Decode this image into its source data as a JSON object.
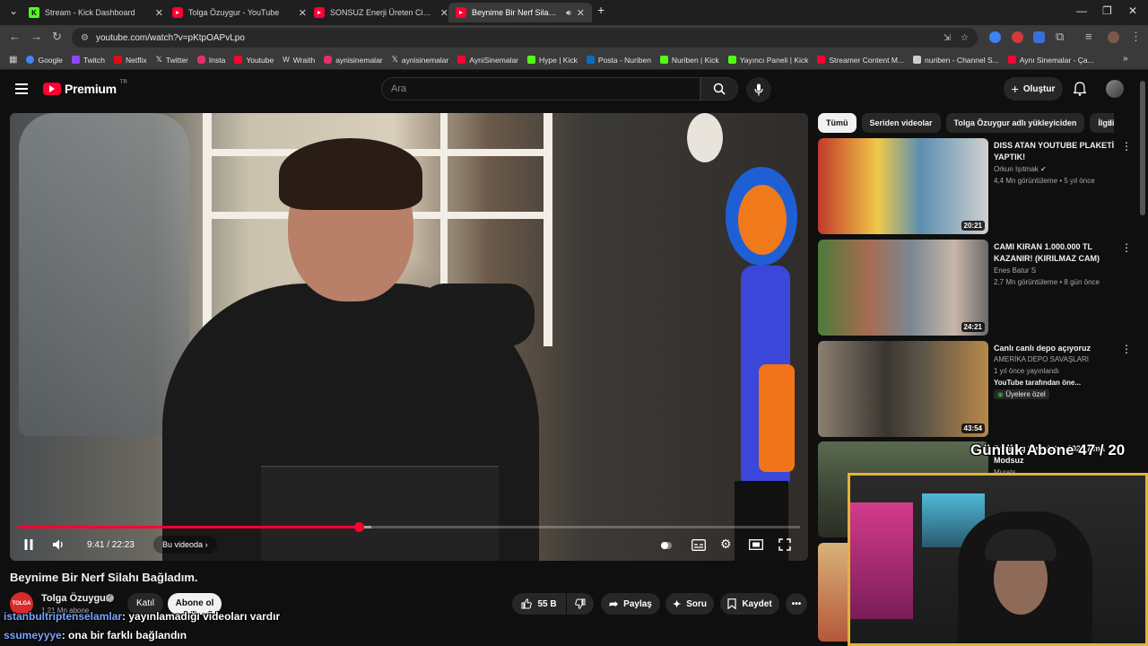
{
  "browser": {
    "tabs": [
      {
        "label": "Stream - Kick Dashboard",
        "icon": "kick-icon"
      },
      {
        "label": "Tolga Özuygur - YouTube",
        "icon": "youtube-icon"
      },
      {
        "label": "SONSUZ Enerji Üreten Cihaz Ya",
        "icon": "youtube-icon"
      },
      {
        "label": "Beynime Bir Nerf Silahı Bağ",
        "icon": "youtube-icon"
      }
    ],
    "url": "youtube.com/watch?v=pKtpOAPvLpo",
    "bookmarks": [
      {
        "label": "Google",
        "color": "#4285f4"
      },
      {
        "label": "Twitch",
        "color": "#9146ff"
      },
      {
        "label": "Netflix",
        "color": "#e50914"
      },
      {
        "label": "Twitter",
        "color": "#e8e8e8"
      },
      {
        "label": "Insta",
        "color": "#e1306c"
      },
      {
        "label": "Youtube",
        "color": "#ff0033"
      },
      {
        "label": "Wraith",
        "color": "#cccccc"
      },
      {
        "label": "aynisinemalar",
        "color": "#e1306c"
      },
      {
        "label": "aynisinemalar",
        "color": "#e8e8e8"
      },
      {
        "label": "AyniSinemalar",
        "color": "#ff0033"
      },
      {
        "label": "Hype | Kick",
        "color": "#53fc18"
      },
      {
        "label": "Posta - Nuriben",
        "color": "#0f6cbd"
      },
      {
        "label": "Nuriben | Kick",
        "color": "#53fc18"
      },
      {
        "label": "Yayıncı Paneli | Kick",
        "color": "#53fc18"
      },
      {
        "label": "Streamer Content M...",
        "color": "#ff0033"
      },
      {
        "label": "nuriben - Channel S...",
        "color": "#cccccc"
      },
      {
        "label": "Aynı Sinemalar - Ça...",
        "color": "#ff0033"
      }
    ]
  },
  "youtube": {
    "logo_word": "Premium",
    "logo_region": "TR",
    "search_placeholder": "Ara",
    "create_label": "Oluştur"
  },
  "video": {
    "title": "Beynime Bir Nerf Silahı Bağladım.",
    "time": "9:41 / 22:23",
    "chapter": "Bu videoda",
    "progress": 0.436,
    "buffered": 0.452,
    "channel": {
      "name": "Tolga Özuygur",
      "avatar_text": "TOLGA",
      "subscribers": "1,21 Mn abone",
      "join_label": "Katıl",
      "subscribe_label": "Abone ol"
    },
    "actions": {
      "likes": "55 B",
      "share": "Paylaş",
      "ask": "Soru",
      "save": "Kaydet"
    }
  },
  "chat": [
    {
      "user": "istanbultriptenselamlar",
      "message": ": yayınlamadığı videoları vardır"
    },
    {
      "user": "ssumeyyye",
      "message": ": ona bir farklı bağlandın"
    }
  ],
  "sidebar": {
    "chips": [
      "Tümü",
      "Seriden videolar",
      "Tolga Özuygur adlı yükleyiciden",
      "İlgili"
    ],
    "recommendations": [
      {
        "title": "DISS ATAN YOUTUBE PLAKETİ YAPTIK!",
        "channel": "Orkun Işıtmak",
        "verified": true,
        "meta": "4,4 Mn görüntüleme • 5 yıl önce",
        "duration": "20:21"
      },
      {
        "title": "CAMI KIRAN 1.000.000 TL KAZANIR! (KIRILMAZ CAM)",
        "channel": "Enes Batur S",
        "verified": false,
        "meta": "2,7 Mn görüntüleme • 8 gün önce",
        "duration": "24:21"
      },
      {
        "title": "Canlı canlı depo açıyoruz",
        "channel": "AMERİKA DEPO SAVAŞLARI",
        "verified": false,
        "meta": "1 yıl önce yayınlandı",
        "extra": "YouTube tarafından öne...",
        "badge": "Üyelere özel",
        "duration": "43:54"
      },
      {
        "title": "Farming Simulator 2025 Ama Modsuz",
        "channel": "Murats",
        "verified": false,
        "meta": "",
        "duration": ""
      }
    ]
  },
  "overlay": {
    "sub_counter": "Günlük Abone 47 / 20"
  }
}
